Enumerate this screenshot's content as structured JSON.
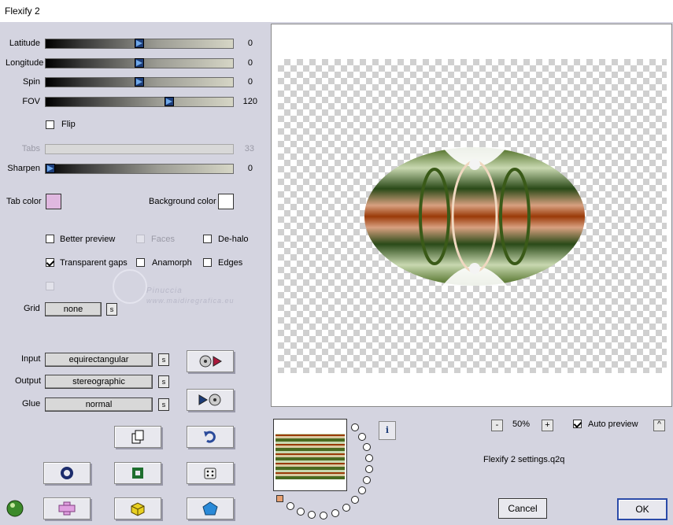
{
  "window": {
    "title": "Flexify 2"
  },
  "sliders": [
    {
      "label": "Latitude",
      "value": "0",
      "level": 0.5,
      "disabled": false
    },
    {
      "label": "Longitude",
      "value": "0",
      "level": 0.5,
      "disabled": false
    },
    {
      "label": "Spin",
      "value": "0",
      "level": 0.5,
      "disabled": false
    },
    {
      "label": "FOV",
      "value": "120",
      "level": 0.66,
      "disabled": false
    },
    {
      "label": "Tabs",
      "value": "33",
      "level": 0.33,
      "disabled": true
    },
    {
      "label": "Sharpen",
      "value": "0",
      "level": 0.0,
      "disabled": false
    }
  ],
  "flip": {
    "label": "Flip",
    "checked": false
  },
  "colors": {
    "tab_label": "Tab color",
    "tab_value": "#e0b8e0",
    "bg_label": "Background color",
    "bg_value": "#ffffff"
  },
  "options": {
    "better_preview": "Better preview",
    "faces": "Faces",
    "de_halo": "De-halo",
    "transparent_gaps": "Transparent gaps",
    "anamorph": "Anamorph",
    "edges": "Edges"
  },
  "watermark": {
    "line1": "Pinuccia",
    "line2": "www.maidiregrafica.eu"
  },
  "grid": {
    "label": "Grid",
    "value": "none"
  },
  "mappings": {
    "input_label": "Input",
    "input_value": "equirectangular",
    "output_label": "Output",
    "output_value": "stereographic",
    "glue_label": "Glue",
    "glue_value": "normal",
    "s": "s"
  },
  "zoom": {
    "value": "50%",
    "minus": "-",
    "plus": "+"
  },
  "auto_preview": {
    "label": "Auto preview",
    "checked": true
  },
  "settings_file": "Flexify 2 settings.q2q",
  "info": "i",
  "collapse": "^",
  "buttons": {
    "cancel": "Cancel",
    "ok": "OK"
  },
  "accent_colors": {
    "slider_thumb": "#1c3c78",
    "tab_swatch": "#e0b8e0"
  }
}
